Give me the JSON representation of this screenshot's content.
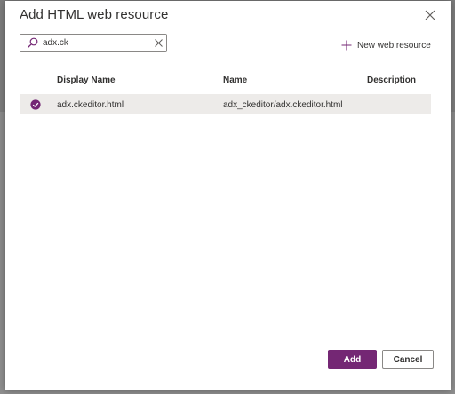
{
  "dialog": {
    "title": "Add HTML web resource",
    "close_icon": "close-icon"
  },
  "search": {
    "value": "adx.ck",
    "icon": "search-icon",
    "clear_icon": "clear-icon"
  },
  "new_resource": {
    "label": "New web resource",
    "icon": "plus-icon"
  },
  "table": {
    "columns": [
      "Display Name",
      "Name",
      "Description"
    ],
    "rows": [
      {
        "selected": true,
        "display_name": "adx.ckeditor.html",
        "name": "adx_ckeditor/adx.ckeditor.html",
        "description": ""
      }
    ]
  },
  "footer": {
    "add_label": "Add",
    "cancel_label": "Cancel"
  },
  "colors": {
    "accent": "#742774",
    "text": "#323130",
    "selected_row": "#edebe9"
  }
}
